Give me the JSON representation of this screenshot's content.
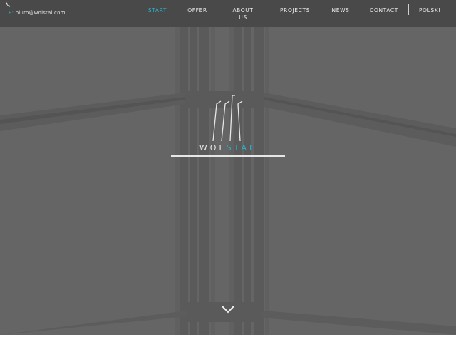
{
  "header": {
    "phone_icon": "phone-icon",
    "email_prefix": "E:",
    "email": "biuro@wolstal.com"
  },
  "nav": {
    "items": [
      {
        "label": "START",
        "active": true
      },
      {
        "label": "OFFER"
      },
      {
        "label": "ABOUT US"
      },
      {
        "label": "PROJECTS"
      },
      {
        "label": "NEWS"
      },
      {
        "label": "CONTACT"
      }
    ],
    "language": "POLSKI"
  },
  "hero": {
    "logo_text_plain": "WOL",
    "logo_text_accent": "STAL",
    "scroll_icon": "chevron-down-icon"
  },
  "colors": {
    "accent": "#2ab0c5",
    "header_bg": "#4a4949",
    "hero_bg": "#666566"
  }
}
